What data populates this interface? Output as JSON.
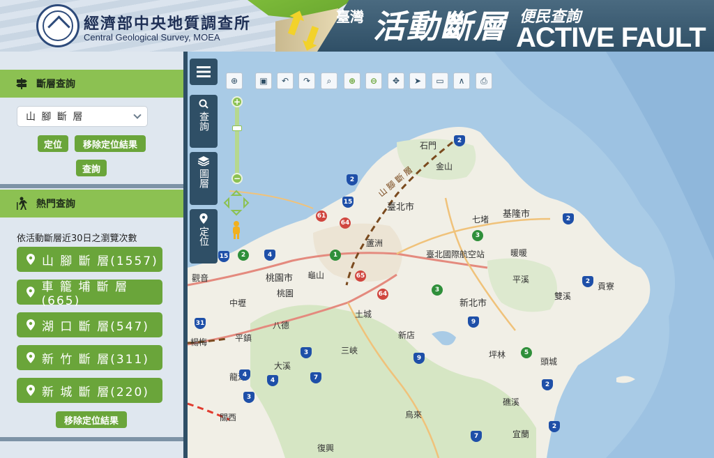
{
  "header": {
    "org_cn": "經濟部中央地質調查所",
    "org_en": "Central Geological Survey, MOEA",
    "title_prefix": "臺灣",
    "title_main": "活動斷層",
    "title_sub": "便民查詢",
    "title_en": "ACTIVE FAULT"
  },
  "sidebar": {
    "fault_query": {
      "heading": "斷層查詢",
      "select_value": "山 腳 斷 層",
      "locate_label": "定位",
      "remove_label": "移除定位結果",
      "query_label": "查詢"
    },
    "popular": {
      "heading": "熱門查詢",
      "hint": "依活動斷層近30日之瀏覽次數",
      "items": [
        {
          "label": "山 腳 斷 層(1557)"
        },
        {
          "label": "車 籠 埔 斷 層(665)"
        },
        {
          "label": "湖 口 斷 層(547)"
        },
        {
          "label": "新 竹 斷 層(311)"
        },
        {
          "label": "新 城 斷 層(220)"
        }
      ],
      "remove_label": "移除定位結果"
    }
  },
  "vtabs": [
    {
      "label": "查詢",
      "icon": "search-icon"
    },
    {
      "label": "圖層",
      "icon": "layers-icon"
    },
    {
      "label": "定位",
      "icon": "pin-icon"
    }
  ],
  "map_labels": {
    "shimen": "石門",
    "jinshan": "金山",
    "taipei": "臺北市",
    "keelung": "基隆市",
    "qidu": "七堵",
    "nuannuan": "暖暖",
    "luzhou": "蘆洲",
    "airport": "臺北國際航空站",
    "taoyuan": "桃園市",
    "guishan": "龜山",
    "taoyuan2": "桃園",
    "guanyin": "觀音",
    "zhongli": "中壢",
    "bade": "八德",
    "tucheng": "土城",
    "newtaipei": "新北市",
    "pingxi": "平溪",
    "shuangxi": "雙溪",
    "gongliao": "貢寮",
    "xindian": "新店",
    "sanxia": "三峽",
    "pinglin": "坪林",
    "toucheng": "頭城",
    "pingzhen": "平鎮",
    "yangmei": "楊梅",
    "daxi": "大溪",
    "longtan": "龍潭",
    "guanxi": "關西",
    "jiaoxi": "礁溪",
    "wulai": "烏來",
    "yilan": "宜蘭",
    "fuxing": "復興",
    "fault_label": "山 腳 斷 層"
  },
  "colors": {
    "green": "#8cc152",
    "button_green": "#6aa53a",
    "dark_blue": "#2f4f66",
    "sea": "#a9cbe6"
  }
}
